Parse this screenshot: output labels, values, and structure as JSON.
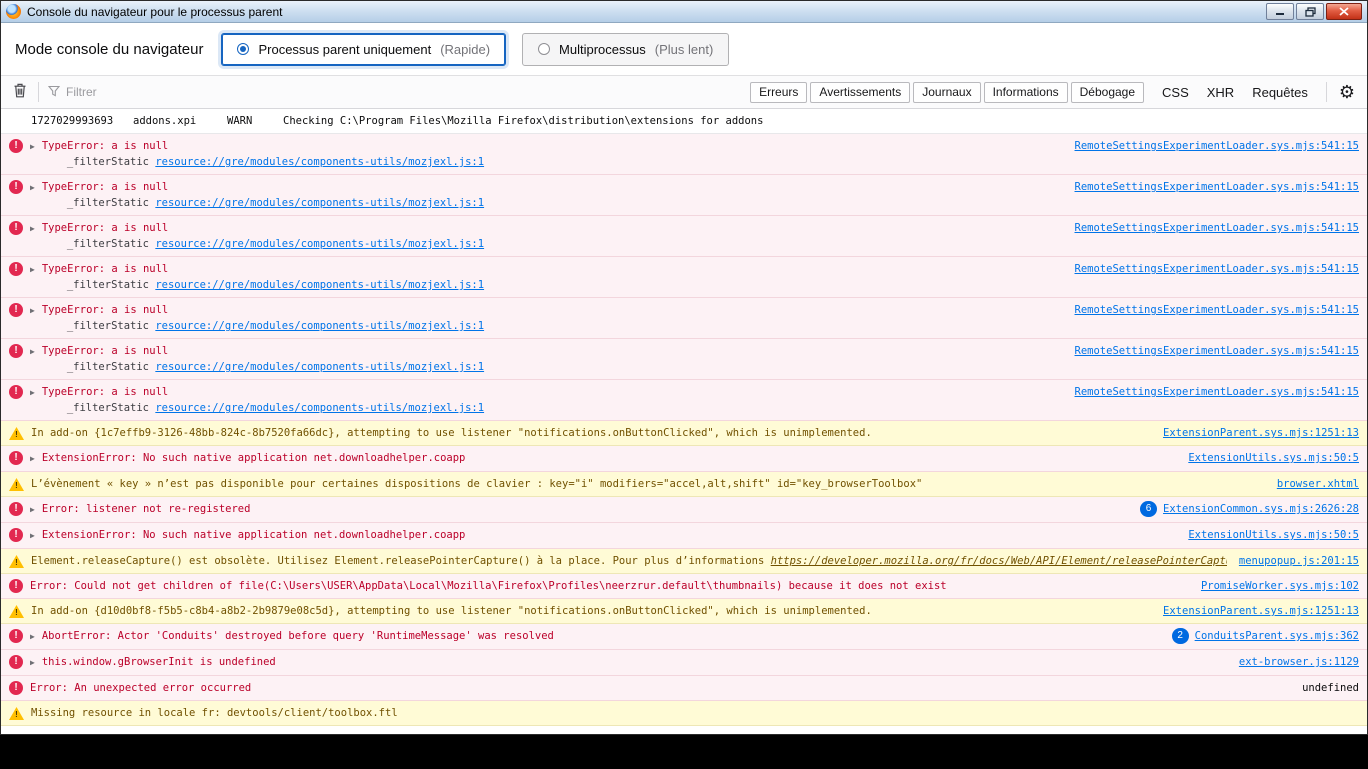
{
  "window": {
    "title": "Console du navigateur pour le processus parent"
  },
  "mode_bar": {
    "label": "Mode console du navigateur",
    "options": [
      {
        "label": "Processus parent uniquement",
        "hint": "(Rapide)",
        "selected": true
      },
      {
        "label": "Multiprocessus",
        "hint": "(Plus lent)",
        "selected": false
      }
    ]
  },
  "filter_bar": {
    "placeholder": "Filtrer",
    "filters": [
      "Erreurs",
      "Avertissements",
      "Journaux",
      "Informations",
      "Débogage"
    ],
    "text_filters": [
      "CSS",
      "XHR",
      "Requêtes"
    ],
    "gear_icon": "⚙"
  },
  "log": {
    "rows": [
      {
        "type": "log",
        "timestamp": "1727029993693",
        "category": "addons.xpi",
        "level": "WARN",
        "text": "Checking C:\\Program Files\\Mozilla Firefox\\distribution\\extensions for addons"
      },
      {
        "type": "error",
        "expandable": true,
        "text": "TypeError: a is null",
        "stack_fn": "_filterStatic",
        "stack_src": "resource://gre/modules/components-utils/mozjexl.js:1",
        "location": "RemoteSettingsExperimentLoader.sys.mjs:541:15"
      },
      {
        "type": "error",
        "expandable": true,
        "text": "TypeError: a is null",
        "stack_fn": "_filterStatic",
        "stack_src": "resource://gre/modules/components-utils/mozjexl.js:1",
        "location": "RemoteSettingsExperimentLoader.sys.mjs:541:15"
      },
      {
        "type": "error",
        "expandable": true,
        "text": "TypeError: a is null",
        "stack_fn": "_filterStatic",
        "stack_src": "resource://gre/modules/components-utils/mozjexl.js:1",
        "location": "RemoteSettingsExperimentLoader.sys.mjs:541:15"
      },
      {
        "type": "error",
        "expandable": true,
        "text": "TypeError: a is null",
        "stack_fn": "_filterStatic",
        "stack_src": "resource://gre/modules/components-utils/mozjexl.js:1",
        "location": "RemoteSettingsExperimentLoader.sys.mjs:541:15"
      },
      {
        "type": "error",
        "expandable": true,
        "text": "TypeError: a is null",
        "stack_fn": "_filterStatic",
        "stack_src": "resource://gre/modules/components-utils/mozjexl.js:1",
        "location": "RemoteSettingsExperimentLoader.sys.mjs:541:15"
      },
      {
        "type": "error",
        "expandable": true,
        "text": "TypeError: a is null",
        "stack_fn": "_filterStatic",
        "stack_src": "resource://gre/modules/components-utils/mozjexl.js:1",
        "location": "RemoteSettingsExperimentLoader.sys.mjs:541:15"
      },
      {
        "type": "error",
        "expandable": true,
        "text": "TypeError: a is null",
        "stack_fn": "_filterStatic",
        "stack_src": "resource://gre/modules/components-utils/mozjexl.js:1",
        "location": "RemoteSettingsExperimentLoader.sys.mjs:541:15"
      },
      {
        "type": "warn",
        "text": "In add-on {1c7effb9-3126-48bb-824c-8b7520fa66dc}, attempting to use listener \"notifications.onButtonClicked\", which is unimplemented.",
        "location": "ExtensionParent.sys.mjs:1251:13"
      },
      {
        "type": "error",
        "expandable": true,
        "text": "ExtensionError: No such native application net.downloadhelper.coapp",
        "location": "ExtensionUtils.sys.mjs:50:5"
      },
      {
        "type": "warn",
        "text": "L’évènement « key » n’est pas disponible pour certaines dispositions de clavier : key=\"i\" modifiers=\"accel,alt,shift\" id=\"key_browserToolbox\"",
        "location": "browser.xhtml"
      },
      {
        "type": "error",
        "expandable": true,
        "text": "Error: listener not re-registered",
        "badge": "6",
        "location": "ExtensionCommon.sys.mjs:2626:28"
      },
      {
        "type": "error",
        "expandable": true,
        "text": "ExtensionError: No such native application net.downloadhelper.coapp",
        "location": "ExtensionUtils.sys.mjs:50:5"
      },
      {
        "type": "warn",
        "text": "Element.releaseCapture() est obsolète. Utilisez Element.releasePointerCapture() à la place. Pour plus d’informations",
        "message_link": "https://developer.mozilla.org/fr/docs/Web/API/Element/releasePointerCapture",
        "location": "menupopup.js:201:15"
      },
      {
        "type": "error",
        "text": "Error: Could not get children of file(C:\\Users\\USER\\AppData\\Local\\Mozilla\\Firefox\\Profiles\\neerzrur.default\\thumbnails) because it does not exist",
        "location": "PromiseWorker.sys.mjs:102"
      },
      {
        "type": "warn",
        "text": "In add-on {d10d0bf8-f5b5-c8b4-a8b2-2b9879e08c5d}, attempting to use listener \"notifications.onButtonClicked\", which is unimplemented.",
        "location": "ExtensionParent.sys.mjs:1251:13"
      },
      {
        "type": "error",
        "expandable": true,
        "text": "AbortError: Actor 'Conduits' destroyed before query 'RuntimeMessage' was resolved",
        "badge": "2",
        "location": "ConduitsParent.sys.mjs:362"
      },
      {
        "type": "error",
        "expandable": true,
        "text": "this.window.gBrowserInit is undefined",
        "location": "ext-browser.js:1129"
      },
      {
        "type": "error",
        "text": "Error: An unexpected error occurred",
        "location": "undefined",
        "location_plain": true
      },
      {
        "type": "warn",
        "text": "Missing resource in locale fr: devtools/client/toolbox.ftl"
      }
    ]
  }
}
